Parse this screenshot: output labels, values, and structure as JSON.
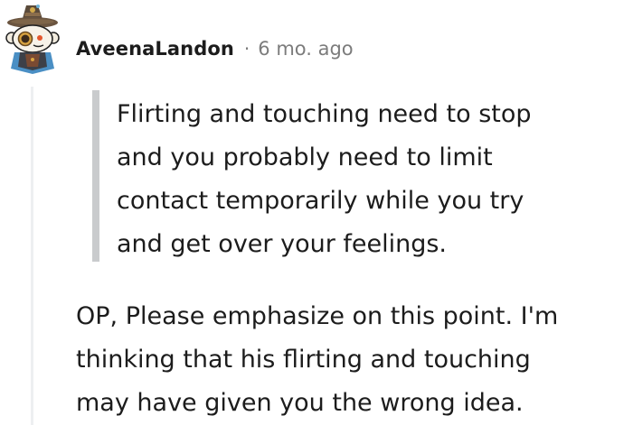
{
  "comment": {
    "author": "AveenaLandon",
    "separator": "·",
    "age": "6 mo. ago",
    "avatar_icon": "snoo-avatar-icon",
    "quote_lines": [
      "Flirting and touching need to stop",
      "and you probably need to limit",
      "contact temporarily while you try",
      "and get over your feelings."
    ],
    "body_lines": [
      "OP, Please emphasize on this point. I'm",
      "thinking that his flirting and touching",
      "may have given you the wrong idea."
    ]
  },
  "colors": {
    "text": "#1c1c1c",
    "meta": "#7c7c7c",
    "quote_bar": "#c9cbcd",
    "thread_line": "#edeff1",
    "avatar_bg": "#4a8fc4"
  }
}
